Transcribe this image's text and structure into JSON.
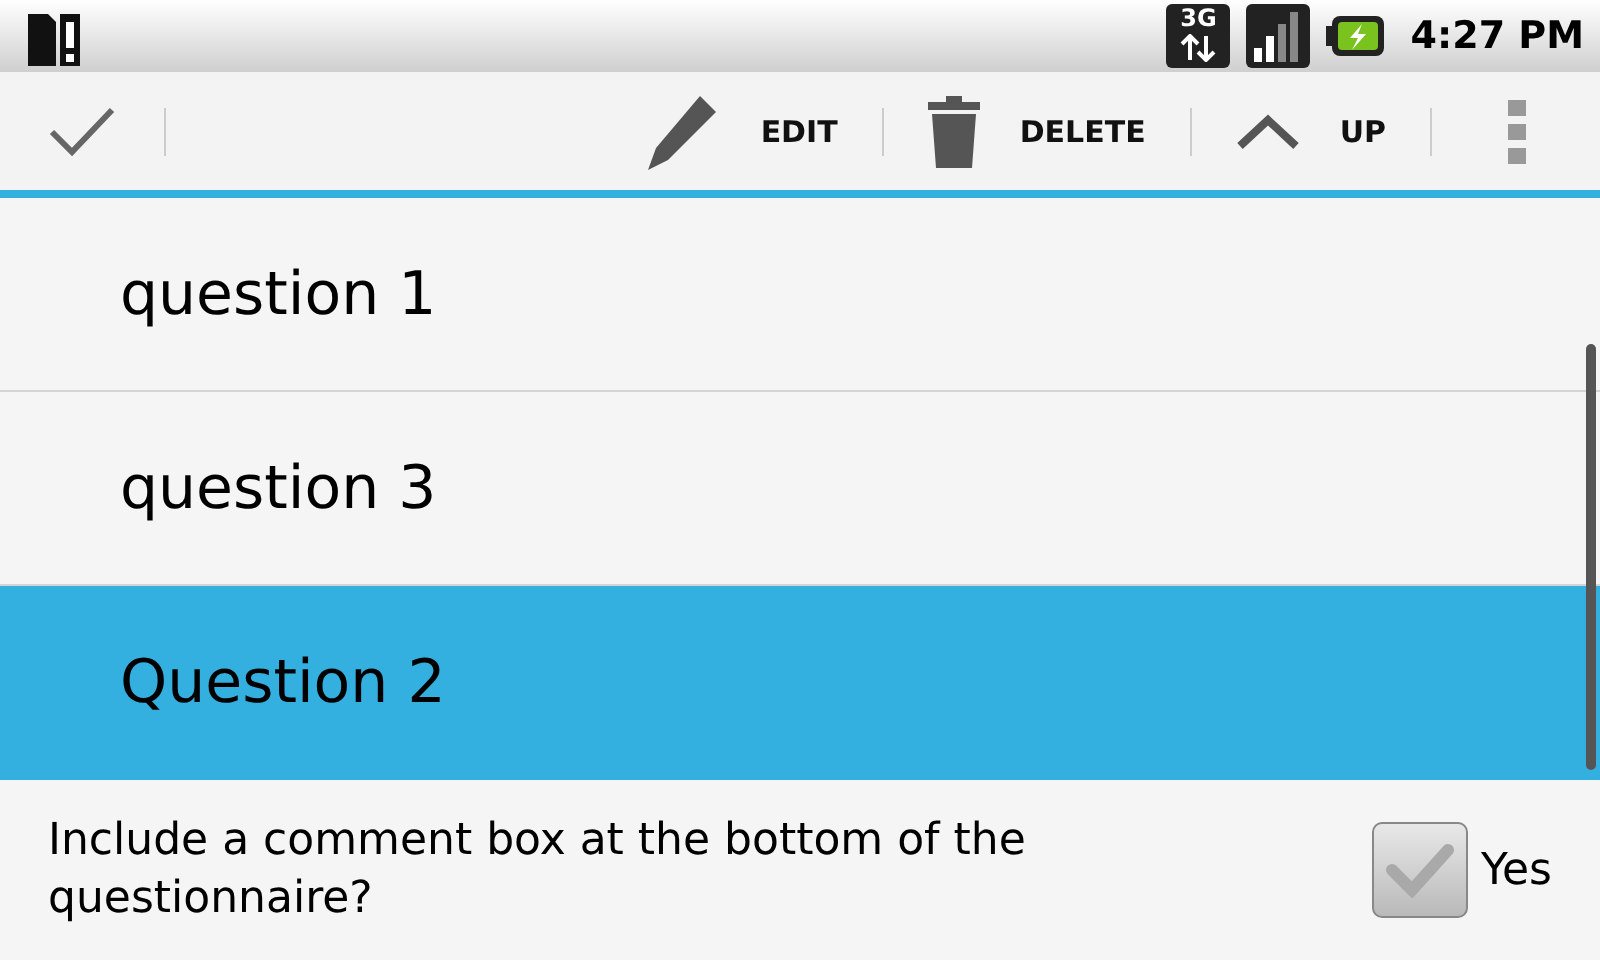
{
  "status_bar": {
    "network": "3G",
    "time": "4:27 PM"
  },
  "action_bar": {
    "actions": [
      {
        "kind": "edit",
        "label": "EDIT"
      },
      {
        "kind": "delete",
        "label": "DELETE"
      },
      {
        "kind": "up",
        "label": "UP"
      }
    ]
  },
  "questions": [
    {
      "label": "question 1",
      "selected": false
    },
    {
      "label": "question 3",
      "selected": false
    },
    {
      "label": "Question 2",
      "selected": true
    }
  ],
  "comment_option": {
    "label": "Include a comment box at the bottom of the questionnaire?",
    "checkbox_label": "Yes",
    "checked": false
  }
}
